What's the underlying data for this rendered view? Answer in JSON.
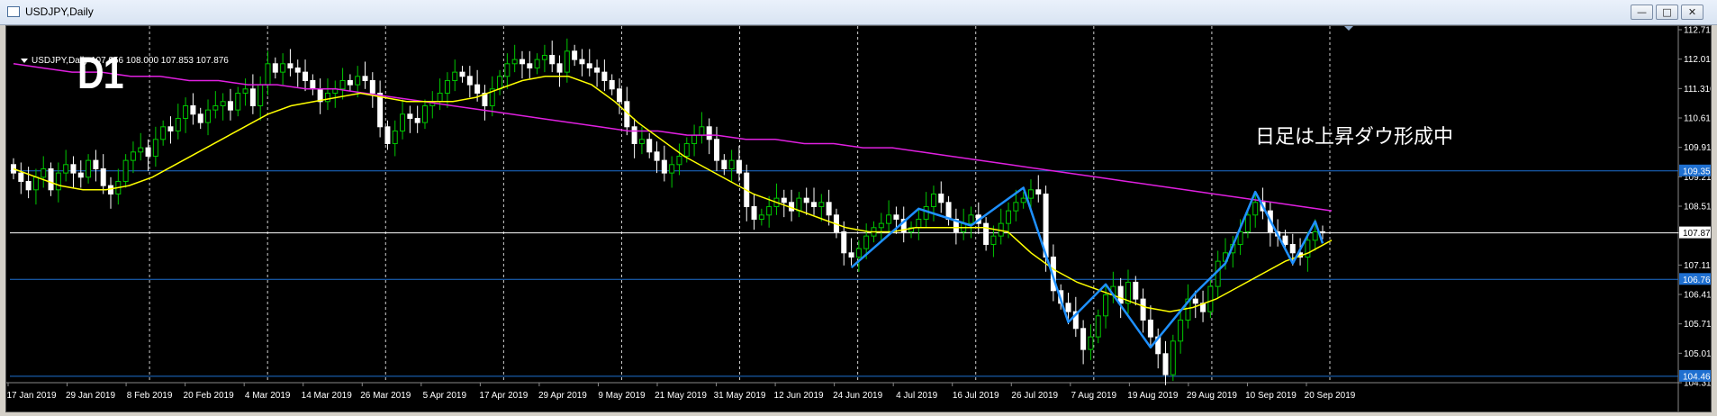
{
  "window": {
    "title": "USDJPY,Daily",
    "minimize": "—",
    "maximize": "□",
    "close": "✕"
  },
  "chart_header": {
    "symbol_line": "USDJPY,Daily  107.956 108.000 107.853 107.876"
  },
  "annotations": {
    "timeframe": "D1",
    "note": "日足は上昇ダウ形成中"
  },
  "colors": {
    "background": "#000000",
    "bull": "#00c800",
    "bear": "#ffffff",
    "ma_fast": "#ffff00",
    "ma_slow": "#e020e0",
    "hand_line": "#1e90ff",
    "hline": "#1e6fd0"
  },
  "chart_data": {
    "type": "candlestick",
    "symbol": "USDJPY",
    "timeframe": "Daily",
    "last_quote": {
      "open": 107.956,
      "high": 108.0,
      "low": 107.853,
      "close": 107.876
    },
    "ylim": [
      104.31,
      112.71
    ],
    "y_ticks": [
      112.71,
      112.01,
      111.31,
      110.61,
      109.91,
      109.21,
      108.51,
      107.876,
      107.11,
      106.41,
      105.71,
      105.01,
      104.31
    ],
    "x_ticks": [
      "17 Jan 2019",
      "29 Jan 2019",
      "8 Feb 2019",
      "20 Feb 2019",
      "4 Mar 2019",
      "14 Mar 2019",
      "26 Mar 2019",
      "5 Apr 2019",
      "17 Apr 2019",
      "29 Apr 2019",
      "9 May 2019",
      "21 May 2019",
      "31 May 2019",
      "12 Jun 2019",
      "24 Jun 2019",
      "4 Jul 2019",
      "16 Jul 2019",
      "26 Jul 2019",
      "7 Aug 2019",
      "19 Aug 2019",
      "29 Aug 2019",
      "10 Sep 2019",
      "20 Sep 2019"
    ],
    "horizontal_levels": [
      {
        "value": 109.35,
        "label": "109.350",
        "color": "#1e6fd0"
      },
      {
        "value": 107.876,
        "label": "107.876",
        "color": "#ffffff"
      },
      {
        "value": 106.768,
        "label": "106.768",
        "color": "#1e6fd0"
      },
      {
        "value": 104.462,
        "label": "104.462",
        "color": "#1e6fd0"
      }
    ],
    "closes": [
      109.3,
      109.1,
      108.9,
      109.2,
      109.4,
      108.9,
      109.3,
      109.5,
      109.3,
      109.2,
      109.6,
      109.4,
      109.0,
      108.8,
      109.1,
      109.6,
      109.8,
      109.9,
      109.7,
      110.1,
      110.4,
      110.3,
      110.6,
      110.9,
      110.7,
      110.5,
      110.8,
      110.9,
      111.0,
      110.8,
      111.2,
      111.3,
      110.9,
      111.4,
      111.9,
      111.7,
      111.9,
      111.8,
      111.7,
      111.5,
      111.3,
      111.0,
      111.2,
      111.3,
      111.5,
      111.4,
      111.6,
      111.5,
      111.2,
      110.4,
      110.0,
      110.3,
      110.7,
      110.6,
      110.5,
      110.9,
      111.0,
      111.2,
      111.5,
      111.7,
      111.6,
      111.4,
      111.2,
      110.9,
      111.3,
      111.6,
      111.9,
      112.0,
      111.9,
      111.8,
      112.0,
      112.1,
      111.9,
      111.7,
      112.2,
      112.0,
      111.9,
      111.8,
      111.7,
      111.5,
      111.3,
      111.0,
      110.4,
      110.0,
      110.1,
      109.8,
      109.6,
      109.3,
      109.5,
      109.7,
      110.0,
      110.2,
      110.4,
      110.1,
      109.6,
      109.4,
      109.6,
      109.3,
      108.5,
      108.2,
      108.3,
      108.5,
      108.7,
      108.6,
      108.4,
      108.7,
      108.6,
      108.5,
      108.6,
      108.3,
      107.9,
      107.4,
      107.3,
      107.5,
      107.8,
      108.0,
      108.1,
      108.3,
      108.2,
      107.9,
      108.0,
      108.2,
      108.5,
      108.8,
      108.6,
      108.2,
      107.9,
      108.1,
      108.3,
      108.1,
      107.6,
      107.8,
      108.1,
      108.4,
      108.6,
      108.7,
      108.9,
      108.8,
      107.3,
      106.5,
      106.2,
      106.0,
      105.6,
      105.1,
      105.4,
      105.9,
      106.4,
      106.6,
      106.2,
      106.7,
      106.3,
      105.8,
      105.4,
      105.0,
      104.5,
      105.3,
      105.8,
      106.3,
      106.2,
      106.0,
      106.6,
      107.2,
      107.4,
      107.6,
      107.9,
      108.3,
      108.6,
      108.4,
      107.9,
      107.8,
      107.6,
      107.4,
      107.3,
      107.7,
      107.9,
      107.876
    ],
    "ma_fast": [
      109.4,
      109.2,
      109.0,
      108.9,
      108.9,
      109.0,
      109.2,
      109.5,
      109.8,
      110.1,
      110.4,
      110.7,
      110.9,
      111.0,
      111.1,
      111.2,
      111.1,
      111.0,
      111.0,
      111.0,
      111.1,
      111.3,
      111.5,
      111.6,
      111.6,
      111.4,
      111.0,
      110.5,
      110.1,
      109.7,
      109.4,
      109.1,
      108.8,
      108.6,
      108.4,
      108.2,
      108.0,
      107.9,
      107.9,
      108.0,
      108.0,
      108.0,
      108.0,
      107.9,
      107.4,
      107.0,
      106.7,
      106.5,
      106.3,
      106.1,
      106.0,
      106.1,
      106.3,
      106.6,
      106.9,
      107.2,
      107.4,
      107.7
    ],
    "ma_slow": [
      111.9,
      111.8,
      111.7,
      111.7,
      111.6,
      111.6,
      111.5,
      111.5,
      111.4,
      111.4,
      111.3,
      111.3,
      111.2,
      111.1,
      111.0,
      110.9,
      110.8,
      110.7,
      110.6,
      110.5,
      110.4,
      110.3,
      110.3,
      110.2,
      110.2,
      110.1,
      110.1,
      110.0,
      110.0,
      109.9,
      109.9,
      109.8,
      109.7,
      109.6,
      109.5,
      109.4,
      109.3,
      109.2,
      109.1,
      109.0,
      108.9,
      108.8,
      108.7,
      108.6,
      108.5,
      108.4
    ]
  }
}
